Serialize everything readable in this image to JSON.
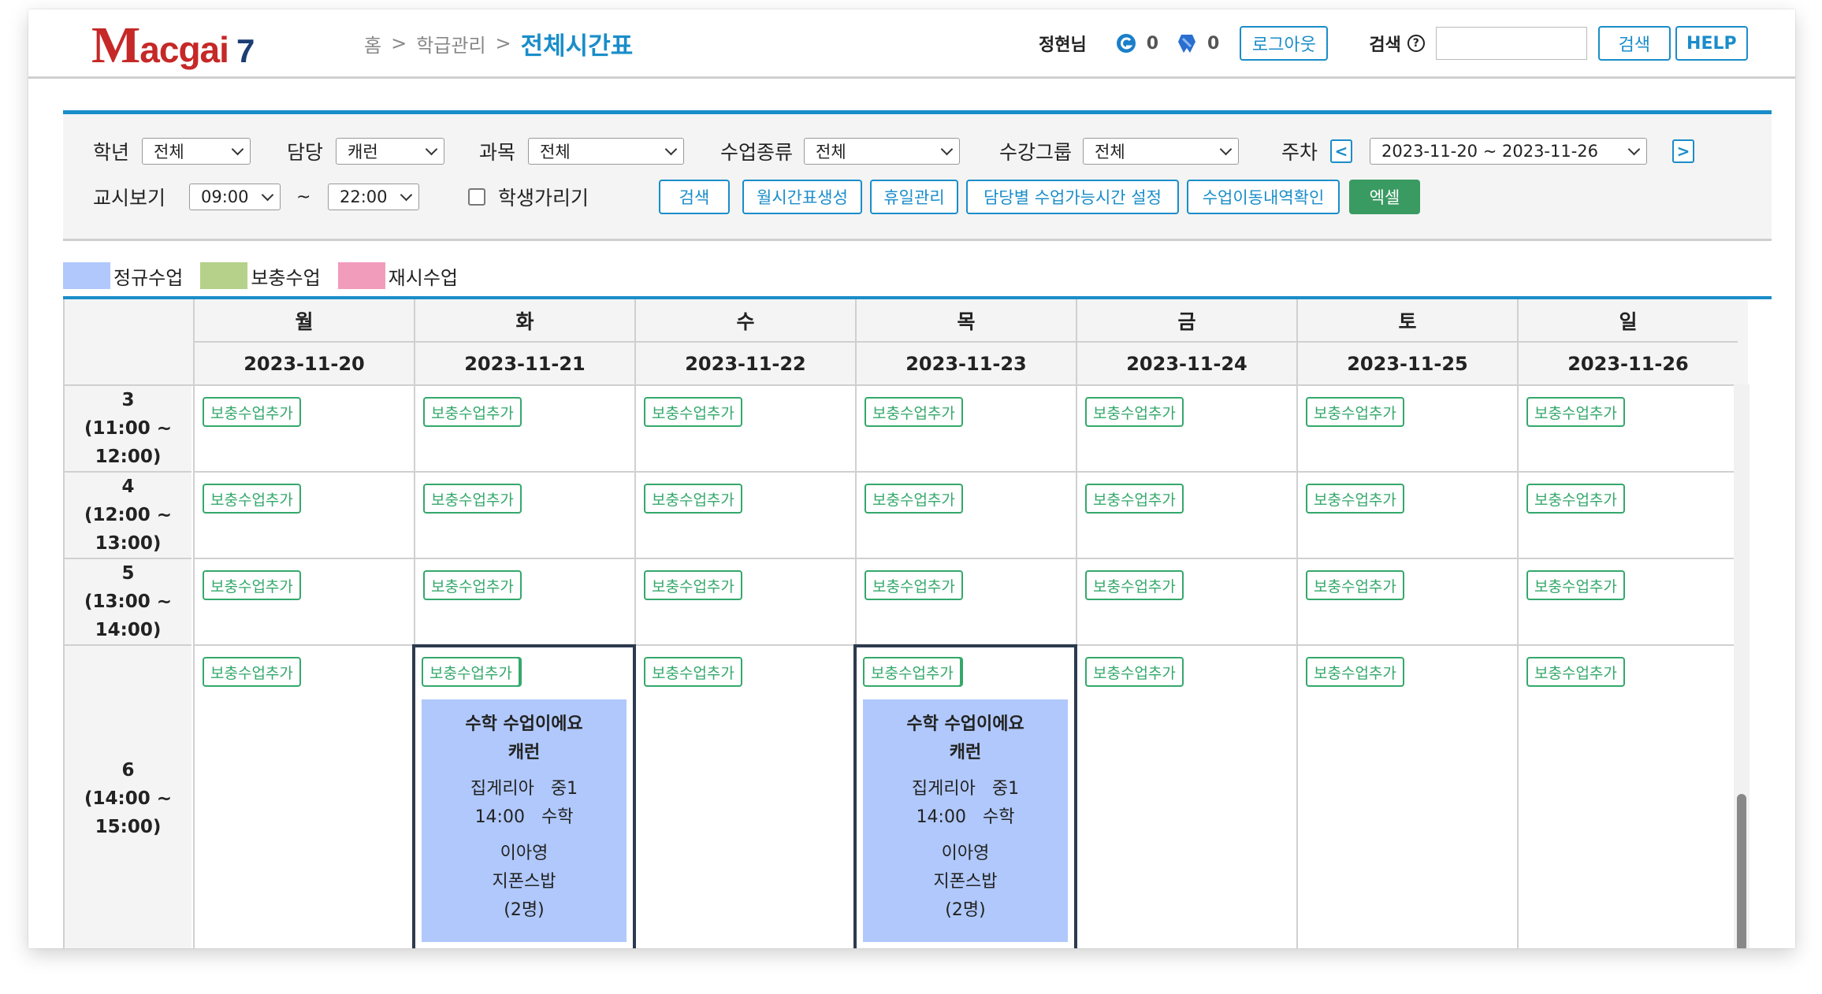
{
  "header": {
    "logo": {
      "m": "M",
      "rest": "acgai",
      "num": "7"
    },
    "breadcrumb": {
      "home": "홈",
      "sep1": ">",
      "section": "학급관리",
      "sep2": ">",
      "current": "전체시간표"
    },
    "user": "정현님",
    "counter1": "0",
    "counter2": "0",
    "logout_label": "로그아웃",
    "search_label": "검색",
    "search_help": "?",
    "search_value": "",
    "search_button": "검색",
    "help_button": "HELP"
  },
  "filters": {
    "grade": {
      "label": "학년",
      "value": "전체"
    },
    "teacher": {
      "label": "담당",
      "value": "캐런"
    },
    "subject": {
      "label": "과목",
      "value": "전체"
    },
    "class_type": {
      "label": "수업종류",
      "value": "전체"
    },
    "course_group": {
      "label": "수강그룹",
      "value": "전체"
    },
    "week": {
      "label": "주차",
      "value": "2023-11-20 ~ 2023-11-26",
      "prev": "<",
      "next": ">"
    },
    "view": {
      "label": "교시보기",
      "start": "09:00",
      "tilde": "~",
      "end": "22:00"
    },
    "hide_students_label": "학생가리기",
    "buttons": {
      "search": "검색",
      "monthly": "월시간표생성",
      "holiday": "휴일관리",
      "availability": "담당별 수업가능시간 설정",
      "move_history": "수업이동내역확인",
      "excel": "엑셀"
    }
  },
  "legend": [
    {
      "label": "정규수업",
      "color": "#b0c8fb"
    },
    {
      "label": "보충수업",
      "color": "#b5d18a"
    },
    {
      "label": "재시수업",
      "color": "#f29cbc"
    }
  ],
  "timetable": {
    "days": [
      "월",
      "화",
      "수",
      "목",
      "금",
      "토",
      "일"
    ],
    "dates": [
      "2023-11-20",
      "2023-11-21",
      "2023-11-22",
      "2023-11-23",
      "2023-11-24",
      "2023-11-25",
      "2023-11-26"
    ],
    "add_label": "보충수업추가",
    "periods": [
      {
        "num": "3",
        "l1": "(11:00 ~",
        "l2": "12:00)"
      },
      {
        "num": "4",
        "l1": "(12:00 ~",
        "l2": "13:00)"
      },
      {
        "num": "5",
        "l1": "(13:00 ~",
        "l2": "14:00)"
      },
      {
        "num": "6",
        "l1": "(14:00 ~",
        "l2": "15:00)"
      }
    ],
    "lessons": [
      {
        "title": "수학 수업이에요",
        "teacher": "캐런",
        "academy": "집게리아",
        "grade": "중1",
        "time": "14:00",
        "subject": "수학",
        "student1": "이아영",
        "student2": "지폰스밥",
        "count": "(2명)"
      },
      {
        "title": "수학 수업이에요",
        "teacher": "캐런",
        "academy": "집게리아",
        "grade": "중1",
        "time": "14:00",
        "subject": "수학",
        "student1": "이아영",
        "student2": "지폰스밥",
        "count": "(2명)"
      }
    ]
  }
}
